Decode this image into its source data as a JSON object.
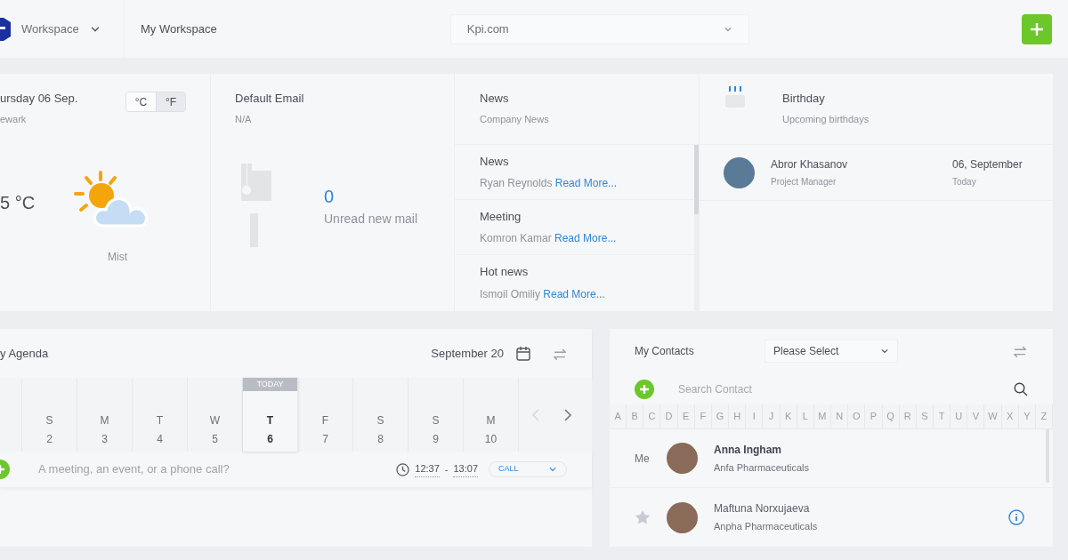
{
  "top_bar": {
    "workspace": "Workspace",
    "breadcrumb": "My Workspace",
    "domain": "Kpi.com"
  },
  "weather": {
    "date": "ursday 06 Sep.",
    "city": "ewark",
    "units": [
      {
        "label": "°C",
        "selected": false
      },
      {
        "label": "°F",
        "selected": true
      }
    ],
    "temperature": "5 °C",
    "condition": "Mist"
  },
  "email": {
    "title": "Default Email",
    "address": "N/A",
    "count": "0",
    "count_label": "Unread new mail"
  },
  "news": {
    "title": "News",
    "subtitle": "Company News",
    "items": [
      {
        "title": "News",
        "author": "Ryan Reynolds",
        "link": "Read More..."
      },
      {
        "title": "Meeting",
        "author": "Komron Kamar",
        "link": "Read More..."
      },
      {
        "title": "Hot news",
        "author": "Ismoil Omiliy",
        "link": "Read More..."
      }
    ]
  },
  "birthday": {
    "title": "Birthday",
    "subtitle": "Upcoming birthdays",
    "people": [
      {
        "name": "Abror Khasanov",
        "role": "Project Manager",
        "date": "06, September",
        "when": "Today"
      }
    ]
  },
  "agenda": {
    "title": "y Agenda",
    "month": "September 20",
    "today_label": "TODAY",
    "days": [
      {
        "weekday": "S",
        "date": "2",
        "selected": false
      },
      {
        "weekday": "M",
        "date": "3",
        "selected": false
      },
      {
        "weekday": "T",
        "date": "4",
        "selected": false
      },
      {
        "weekday": "W",
        "date": "5",
        "selected": false
      },
      {
        "weekday": "T",
        "date": "6",
        "selected": true
      },
      {
        "weekday": "F",
        "date": "7",
        "selected": false
      },
      {
        "weekday": "S",
        "date": "8",
        "selected": false
      },
      {
        "weekday": "S",
        "date": "9",
        "selected": false
      },
      {
        "weekday": "M",
        "date": "10",
        "selected": false
      }
    ],
    "placeholder": "A meeting, an event, or a phone call?",
    "time_start": "12:37",
    "time_separator": "-",
    "time_end": "13:07",
    "type": "CALL"
  },
  "contacts": {
    "title": "My Contacts",
    "filter": "Please Select",
    "search_placeholder": "Search Contact",
    "letters": [
      "A",
      "B",
      "C",
      "D",
      "E",
      "F",
      "G",
      "H",
      "I",
      "J",
      "K",
      "L",
      "M",
      "N",
      "O",
      "P",
      "Q",
      "R",
      "S",
      "T",
      "U",
      "V",
      "W",
      "X",
      "Y",
      "Z"
    ],
    "people": [
      {
        "kind": "me",
        "label": "Me",
        "name": "Anna Ingham",
        "company": "Anfa Pharmaceuticals"
      },
      {
        "kind": "other",
        "name": "Maftuna Norxujaeva",
        "company": "Anpha Pharmaceuticals"
      }
    ]
  }
}
